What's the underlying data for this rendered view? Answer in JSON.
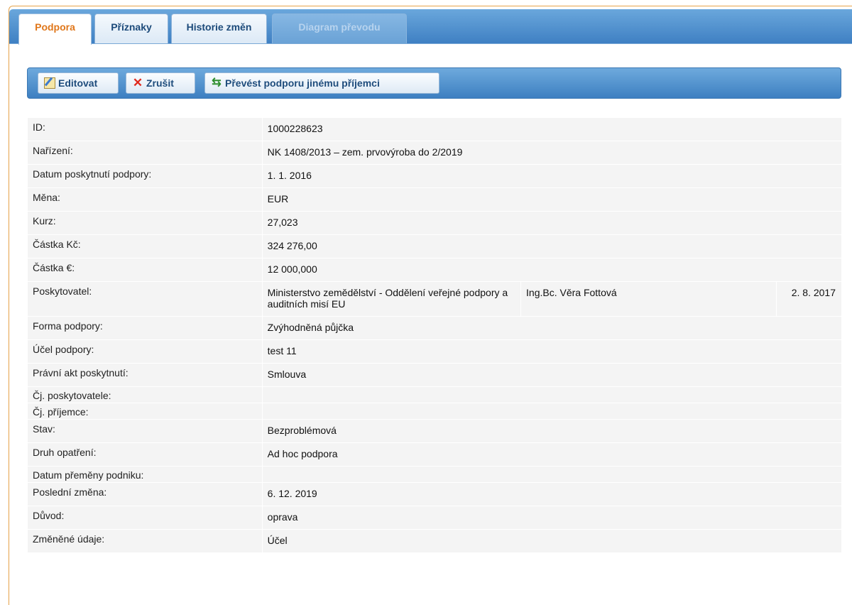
{
  "tabs": [
    {
      "label": "Podpora",
      "state": "active"
    },
    {
      "label": "Příznaky",
      "state": "normal"
    },
    {
      "label": "Historie změn",
      "state": "normal"
    },
    {
      "label": "Diagram převodu",
      "state": "disabled"
    }
  ],
  "toolbar": {
    "edit_label": "Editovat",
    "cancel_label": "Zrušit",
    "transfer_label": "Převést podporu jinému příjemci"
  },
  "rows": [
    {
      "label": "ID:",
      "value": "1000228623"
    },
    {
      "label": "Nařízení:",
      "value": "NK 1408/2013 – zem. prvovýroba do 2/2019"
    },
    {
      "label": "Datum poskytnutí podpory:",
      "value": "1. 1. 2016"
    },
    {
      "label": "Měna:",
      "value": "EUR"
    },
    {
      "label": "Kurz:",
      "value": "27,023"
    },
    {
      "label": "Částka Kč:",
      "value": "324 276,00"
    },
    {
      "label": "Částka €:",
      "value": "12 000,000"
    },
    {
      "label": "Poskytovatel:",
      "value": "Ministerstvo zemědělství - Oddělení veřejné podpory a auditních misí EU",
      "person": "Ing.Bc. Věra Fottová",
      "date": "2. 8. 2017"
    },
    {
      "label": "Forma podpory:",
      "value": "Zvýhodněná půjčka"
    },
    {
      "label": "Účel podpory:",
      "value": "test 11"
    },
    {
      "label": "Právní akt poskytnutí:",
      "value": "Smlouva"
    },
    {
      "label": "Čj. poskytovatele:",
      "value": ""
    },
    {
      "label": "Čj. příjemce:",
      "value": ""
    },
    {
      "label": "Stav:",
      "value": "Bezproblémová"
    },
    {
      "label": "Druh opatření:",
      "value": "Ad hoc podpora"
    },
    {
      "label": "Datum přeměny podniku:",
      "value": ""
    },
    {
      "label": "Poslední změna:",
      "value": "6. 12. 2019"
    },
    {
      "label": "Důvod:",
      "value": "oprava"
    },
    {
      "label": "Změněné údaje:",
      "value": "Účel"
    }
  ],
  "colors": {
    "accent": "#e0771b",
    "tabbar": "#3f80c3",
    "row_bg": "#f4f4f4"
  }
}
